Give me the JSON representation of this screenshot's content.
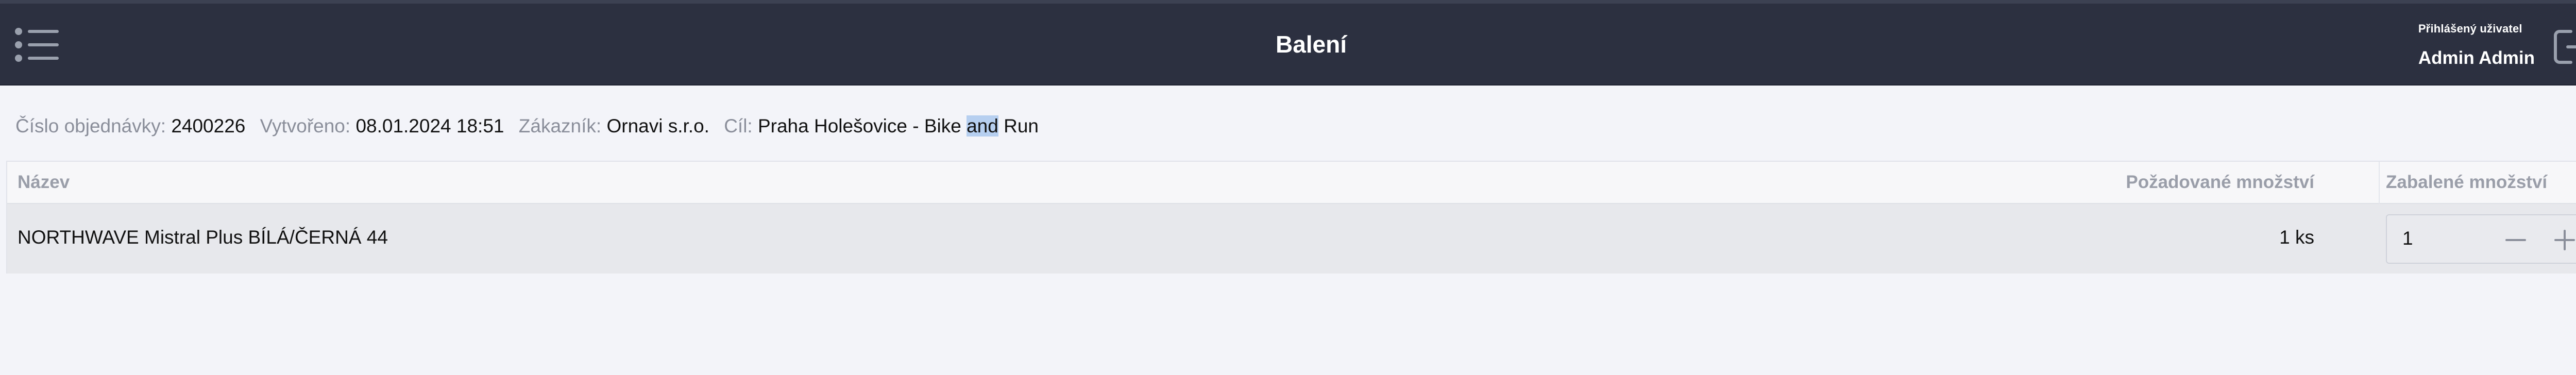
{
  "header": {
    "title": "Balení",
    "user_caption": "Přihlášený uživatel",
    "user_name": "Admin Admin",
    "menu_icon": "list-menu-icon",
    "logout_icon": "logout-icon"
  },
  "order": {
    "number_label": "Číslo objednávky:",
    "number": "2400226",
    "created_label": "Vytvořeno:",
    "created": "08.01.2024 18:51",
    "customer_label": "Zákazník:",
    "customer": "Ornavi s.r.o.",
    "target_label": "Cíl:",
    "target_part1": "Praha Holešovice - Bike ",
    "target_selected": "and",
    "target_part2": " Run"
  },
  "table": {
    "columns": {
      "name": "Název",
      "requested": "Požadované množství",
      "packed": "Zabalené množství"
    },
    "rows": [
      {
        "name": "NORTHWAVE Mistral Plus BÍLÁ/ČERNÁ 44",
        "requested": "1 ks",
        "packed": "1"
      }
    ]
  },
  "colors": {
    "header_bg": "#2c3040",
    "page_bg": "#f3f4f9",
    "row_bg": "#e7e8ec",
    "label_gray": "#8a8e9a"
  }
}
